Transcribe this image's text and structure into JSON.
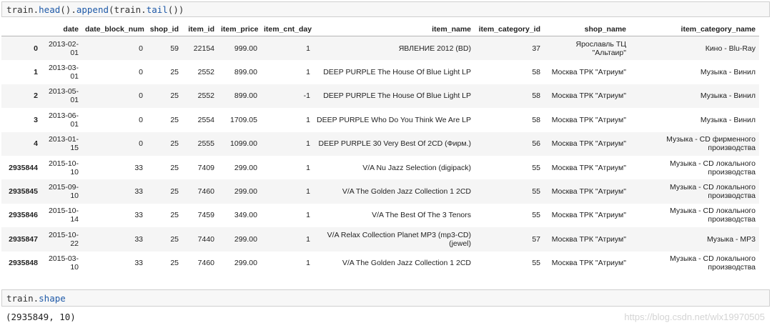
{
  "cell1": {
    "code_obj": "train.",
    "code_fn1": "head",
    "code_mid": "().",
    "code_fn2": "append",
    "code_mid2": "(train.",
    "code_fn3": "tail",
    "code_end": "())"
  },
  "table": {
    "columns": [
      "",
      "date",
      "date_block_num",
      "shop_id",
      "item_id",
      "item_price",
      "item_cnt_day",
      "item_name",
      "item_category_id",
      "shop_name",
      "item_category_name"
    ],
    "rows": [
      [
        "0",
        "2013-02-01",
        "0",
        "59",
        "22154",
        "999.00",
        "1",
        "ЯВЛЕНИЕ 2012 (BD)",
        "37",
        "Ярославль ТЦ \"Альтаир\"",
        "Кино - Blu-Ray"
      ],
      [
        "1",
        "2013-03-01",
        "0",
        "25",
        "2552",
        "899.00",
        "1",
        "DEEP PURPLE The House Of Blue Light LP",
        "58",
        "Москва ТРК \"Атриум\"",
        "Музыка - Винил"
      ],
      [
        "2",
        "2013-05-01",
        "0",
        "25",
        "2552",
        "899.00",
        "-1",
        "DEEP PURPLE The House Of Blue Light LP",
        "58",
        "Москва ТРК \"Атриум\"",
        "Музыка - Винил"
      ],
      [
        "3",
        "2013-06-01",
        "0",
        "25",
        "2554",
        "1709.05",
        "1",
        "DEEP PURPLE Who Do You Think We Are LP",
        "58",
        "Москва ТРК \"Атриум\"",
        "Музыка - Винил"
      ],
      [
        "4",
        "2013-01-15",
        "0",
        "25",
        "2555",
        "1099.00",
        "1",
        "DEEP PURPLE 30 Very Best Of 2CD (Фирм.)",
        "56",
        "Москва ТРК \"Атриум\"",
        "Музыка - CD фирменного производства"
      ],
      [
        "2935844",
        "2015-10-10",
        "33",
        "25",
        "7409",
        "299.00",
        "1",
        "V/A Nu Jazz Selection (digipack)",
        "55",
        "Москва ТРК \"Атриум\"",
        "Музыка - CD локального производства"
      ],
      [
        "2935845",
        "2015-09-10",
        "33",
        "25",
        "7460",
        "299.00",
        "1",
        "V/A The Golden Jazz Collection 1 2CD",
        "55",
        "Москва ТРК \"Атриум\"",
        "Музыка - CD локального производства"
      ],
      [
        "2935846",
        "2015-10-14",
        "33",
        "25",
        "7459",
        "349.00",
        "1",
        "V/A The Best Of The 3 Tenors",
        "55",
        "Москва ТРК \"Атриум\"",
        "Музыка - CD локального производства"
      ],
      [
        "2935847",
        "2015-10-22",
        "33",
        "25",
        "7440",
        "299.00",
        "1",
        "V/A Relax Collection Planet MP3 (mp3-CD) (jewel)",
        "57",
        "Москва ТРК \"Атриум\"",
        "Музыка - MP3"
      ],
      [
        "2935848",
        "2015-03-10",
        "33",
        "25",
        "7460",
        "299.00",
        "1",
        "V/A The Golden Jazz Collection 1 2CD",
        "55",
        "Москва ТРК \"Атриум\"",
        "Музыка - CD локального производства"
      ]
    ]
  },
  "cell2": {
    "code_obj": "train.",
    "code_attr": "shape"
  },
  "output": {
    "text": "(2935849, 10)"
  },
  "watermark": {
    "text": "https://blog.csdn.net/wlx19970505"
  }
}
